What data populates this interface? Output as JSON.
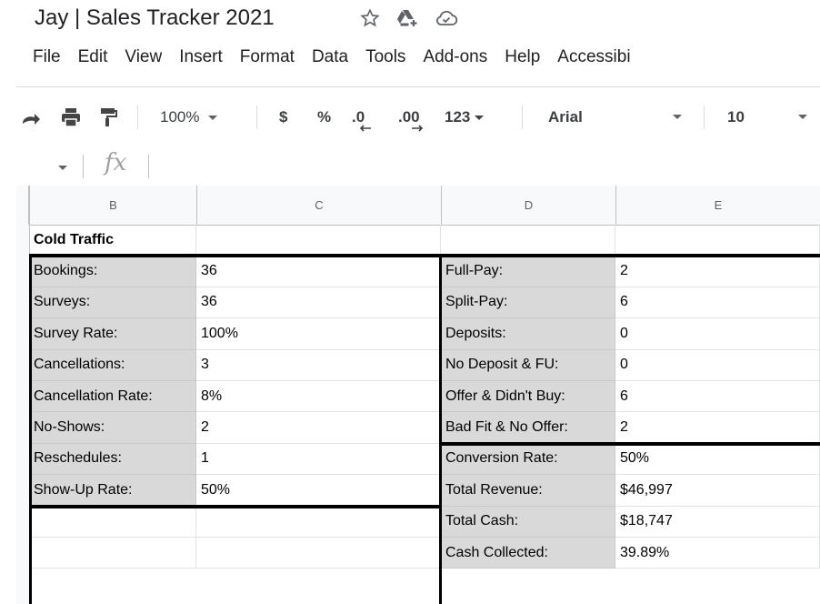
{
  "doc": {
    "title": "Jay | Sales Tracker 2021"
  },
  "menu": [
    "File",
    "Edit",
    "View",
    "Insert",
    "Format",
    "Data",
    "Tools",
    "Add-ons",
    "Help",
    "Accessibi"
  ],
  "toolbar": {
    "zoom": "100%",
    "currency": "$",
    "percent": "%",
    "dec_decrease": ".0",
    "dec_increase": ".00",
    "format_more": "123",
    "font": "Arial",
    "font_size": "10"
  },
  "formula": {
    "fx": "fx",
    "value": ""
  },
  "columns": [
    "B",
    "C",
    "D",
    "E"
  ],
  "section_title": "Cold Traffic",
  "left_table": [
    {
      "label": "Bookings:",
      "value": "36"
    },
    {
      "label": "Surveys:",
      "value": "36"
    },
    {
      "label": "Survey Rate:",
      "value": "100%"
    },
    {
      "label": "Cancellations:",
      "value": "3"
    },
    {
      "label": "Cancellation Rate:",
      "value": "8%"
    },
    {
      "label": "No-Shows:",
      "value": "2"
    },
    {
      "label": "Reschedules:",
      "value": "1"
    },
    {
      "label": "Show-Up Rate:",
      "value": "50%"
    }
  ],
  "right_table": [
    {
      "label": "Full-Pay:",
      "value": "2"
    },
    {
      "label": "Split-Pay:",
      "value": "6"
    },
    {
      "label": "Deposits:",
      "value": "0"
    },
    {
      "label": "No Deposit & FU:",
      "value": "0"
    },
    {
      "label": "Offer & Didn't Buy:",
      "value": "6"
    },
    {
      "label": "Bad Fit & No Offer:",
      "value": "2"
    },
    {
      "label": "Conversion Rate:",
      "value": "50%"
    },
    {
      "label": "Total Revenue:",
      "value": "$46,997"
    },
    {
      "label": "Total Cash:",
      "value": "$18,747"
    },
    {
      "label": "Cash Collected:",
      "value": "39.89%"
    }
  ]
}
